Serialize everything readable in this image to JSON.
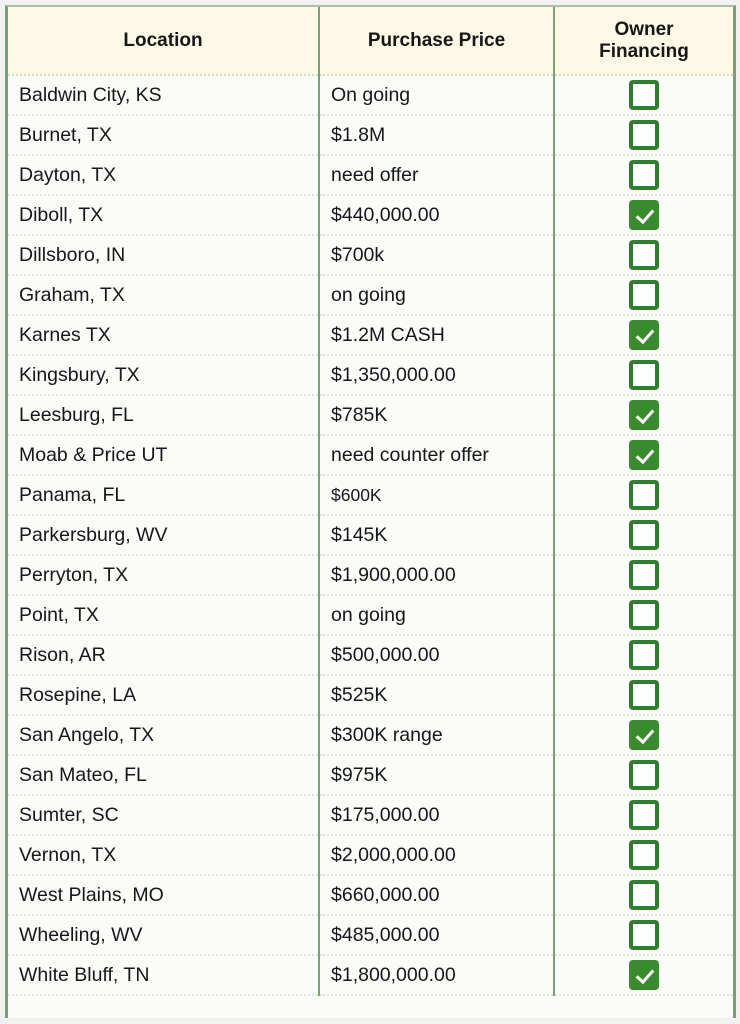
{
  "table": {
    "columns": [
      {
        "key": "location",
        "label": "Location"
      },
      {
        "key": "price",
        "label": "Purchase Price"
      },
      {
        "key": "owner_financing",
        "label": "Owner\nFinancing"
      }
    ],
    "colors": {
      "header_bg": "#fdf9e6",
      "grid_line": "#7d9e7b",
      "row_divider": "#dbe6d6",
      "checkbox_green": "#2f7d2f",
      "checkbox_checked_fill": "#3a8a30",
      "page_bg": "#f1f1ef",
      "cell_bg": "#fbfbf8",
      "text": "#14181c"
    },
    "rows": [
      {
        "location": "Baldwin City, KS",
        "price": "On going",
        "owner_financing": false,
        "small_price": false
      },
      {
        "location": "Burnet, TX",
        "price": "$1.8M",
        "owner_financing": false,
        "small_price": false
      },
      {
        "location": "Dayton, TX",
        "price": "need offer",
        "owner_financing": false,
        "small_price": false
      },
      {
        "location": "Diboll, TX",
        "price": "$440,000.00",
        "owner_financing": true,
        "small_price": false
      },
      {
        "location": "Dillsboro, IN",
        "price": "$700k",
        "owner_financing": false,
        "small_price": false
      },
      {
        "location": "Graham, TX",
        "price": "on going",
        "owner_financing": false,
        "small_price": false
      },
      {
        "location": "Karnes TX",
        "price": "$1.2M CASH",
        "owner_financing": true,
        "small_price": false
      },
      {
        "location": "Kingsbury, TX",
        "price": "$1,350,000.00",
        "owner_financing": false,
        "small_price": false
      },
      {
        "location": "Leesburg, FL",
        "price": "$785K",
        "owner_financing": true,
        "small_price": false
      },
      {
        "location": "Moab & Price UT",
        "price": "need counter offer",
        "owner_financing": true,
        "small_price": false
      },
      {
        "location": "Panama, FL",
        "price": "$600K",
        "owner_financing": false,
        "small_price": true
      },
      {
        "location": "Parkersburg, WV",
        "price": "$145K",
        "owner_financing": false,
        "small_price": false
      },
      {
        "location": "Perryton, TX",
        "price": "$1,900,000.00",
        "owner_financing": false,
        "small_price": false
      },
      {
        "location": "Point, TX",
        "price": "on going",
        "owner_financing": false,
        "small_price": false
      },
      {
        "location": "Rison, AR",
        "price": "$500,000.00",
        "owner_financing": false,
        "small_price": false
      },
      {
        "location": "Rosepine, LA",
        "price": "$525K",
        "owner_financing": false,
        "small_price": false
      },
      {
        "location": "San Angelo, TX",
        "price": "$300K range",
        "owner_financing": true,
        "small_price": false
      },
      {
        "location": "San Mateo, FL",
        "price": "$975K",
        "owner_financing": false,
        "small_price": false
      },
      {
        "location": "Sumter, SC",
        "price": "$175,000.00",
        "owner_financing": false,
        "small_price": false
      },
      {
        "location": "Vernon, TX",
        "price": "$2,000,000.00",
        "owner_financing": false,
        "small_price": false
      },
      {
        "location": "West Plains, MO",
        "price": "$660,000.00",
        "owner_financing": false,
        "small_price": false
      },
      {
        "location": "Wheeling, WV",
        "price": "$485,000.00",
        "owner_financing": false,
        "small_price": false
      },
      {
        "location": "White Bluff, TN",
        "price": "$1,800,000.00",
        "owner_financing": true,
        "small_price": false
      }
    ]
  }
}
